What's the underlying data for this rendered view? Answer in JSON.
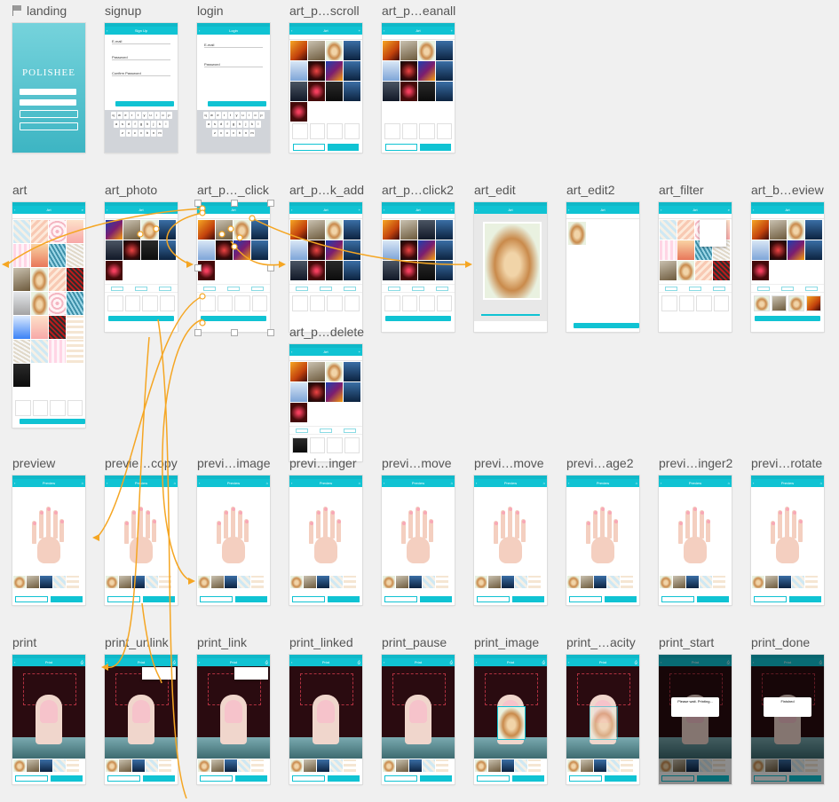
{
  "boards": [
    {
      "id": "landing",
      "title": "landing",
      "flag": true
    },
    {
      "id": "signup",
      "title": "signup"
    },
    {
      "id": "login",
      "title": "login"
    },
    {
      "id": "art_p_scroll",
      "title": "art_p…scroll"
    },
    {
      "id": "art_p_eanall",
      "title": "art_p…eanall"
    },
    {
      "id": "art",
      "title": "art"
    },
    {
      "id": "art_photo",
      "title": "art_photo"
    },
    {
      "id": "art_p_click",
      "title": "art_p…_click"
    },
    {
      "id": "art_p_k_add",
      "title": "art_p…k_add"
    },
    {
      "id": "art_p_click2",
      "title": "art_p…click2"
    },
    {
      "id": "art_edit",
      "title": "art_edit"
    },
    {
      "id": "art_edit2",
      "title": "art_edit2"
    },
    {
      "id": "art_filter",
      "title": "art_filter"
    },
    {
      "id": "art_b_eview",
      "title": "art_b…eview"
    },
    {
      "id": "art_p_delete",
      "title": "art_p…delete"
    },
    {
      "id": "preview",
      "title": "preview"
    },
    {
      "id": "previe_copy",
      "title": "previe…copy"
    },
    {
      "id": "previ_image",
      "title": "previ…image"
    },
    {
      "id": "previ_inger",
      "title": "previ…inger"
    },
    {
      "id": "previ_move",
      "title": "previ…move"
    },
    {
      "id": "previ_move2",
      "title": "previ…move"
    },
    {
      "id": "previ_age2",
      "title": "previ…age2"
    },
    {
      "id": "previ_inger2",
      "title": "previ…inger2"
    },
    {
      "id": "previ_rotate",
      "title": "previ…rotate"
    },
    {
      "id": "print",
      "title": "print"
    },
    {
      "id": "print_unlink",
      "title": "print_unlink"
    },
    {
      "id": "print_link",
      "title": "print_link"
    },
    {
      "id": "print_linked",
      "title": "print_linked"
    },
    {
      "id": "print_pause",
      "title": "print_pause"
    },
    {
      "id": "print_image",
      "title": "print_image"
    },
    {
      "id": "print_acity",
      "title": "print_…acity"
    },
    {
      "id": "print_start",
      "title": "print_start"
    },
    {
      "id": "print_done",
      "title": "print_done"
    }
  ],
  "screens": {
    "landing": {
      "wordmark": "POLISHEE"
    },
    "signup": {
      "nav": "Sign Up",
      "email": "E-mail",
      "password": "Password",
      "confirm": "Confirm Password"
    },
    "login": {
      "nav": "Login",
      "email": "E-mail",
      "password": "Password"
    },
    "art": {
      "nav": "Art"
    },
    "preview": {
      "nav": "Preview"
    },
    "print": {
      "nav": "Print"
    },
    "print_start": {
      "modal": "Please wait. Printing..."
    },
    "print_done": {
      "modal": "Finished"
    }
  },
  "keyboard": {
    "row1": [
      "q",
      "w",
      "e",
      "r",
      "t",
      "y",
      "u",
      "i",
      "o",
      "p"
    ],
    "row2": [
      "a",
      "s",
      "d",
      "f",
      "g",
      "h",
      "j",
      "k",
      "l"
    ],
    "row3": [
      "z",
      "x",
      "c",
      "v",
      "b",
      "n",
      "m"
    ]
  },
  "colors": {
    "accent": "#10c3d3",
    "flow": "#f5a623"
  }
}
